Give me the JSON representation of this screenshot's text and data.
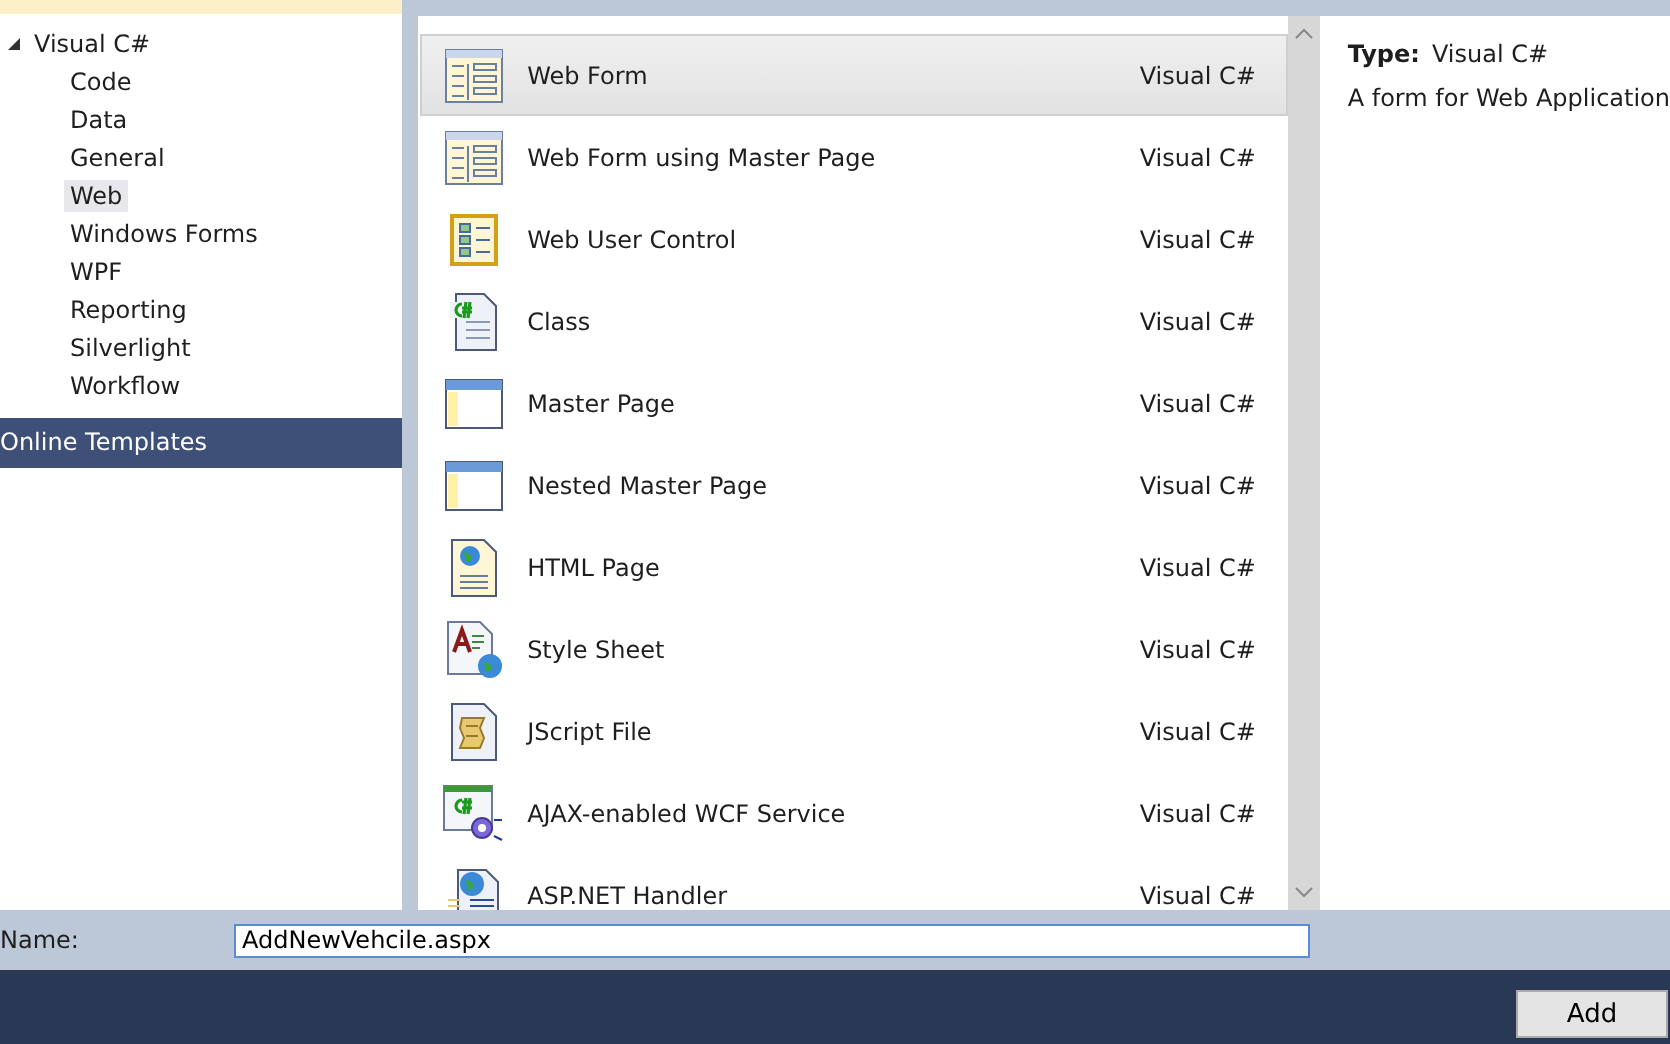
{
  "tree": {
    "root": {
      "label": "Visual C#",
      "expanded": true,
      "children": [
        {
          "label": "Code",
          "selected": false
        },
        {
          "label": "Data",
          "selected": false
        },
        {
          "label": "General",
          "selected": false
        },
        {
          "label": "Web",
          "selected": true
        },
        {
          "label": "Windows Forms",
          "selected": false
        },
        {
          "label": "WPF",
          "selected": false
        },
        {
          "label": "Reporting",
          "selected": false
        },
        {
          "label": "Silverlight",
          "selected": false
        },
        {
          "label": "Workflow",
          "selected": false
        }
      ]
    },
    "section": {
      "label": "Online Templates",
      "selected": true
    }
  },
  "templates": [
    {
      "name": "Web Form",
      "language": "Visual C#",
      "kind": "form",
      "selected": true
    },
    {
      "name": "Web Form using Master Page",
      "language": "Visual C#",
      "kind": "form",
      "selected": false
    },
    {
      "name": "Web User Control",
      "language": "Visual C#",
      "kind": "control",
      "selected": false
    },
    {
      "name": "Class",
      "language": "Visual C#",
      "kind": "class",
      "selected": false
    },
    {
      "name": "Master Page",
      "language": "Visual C#",
      "kind": "master",
      "selected": false
    },
    {
      "name": "Nested Master Page",
      "language": "Visual C#",
      "kind": "master",
      "selected": false
    },
    {
      "name": "HTML Page",
      "language": "Visual C#",
      "kind": "html",
      "selected": false
    },
    {
      "name": "Style Sheet",
      "language": "Visual C#",
      "kind": "css",
      "selected": false
    },
    {
      "name": "JScript File",
      "language": "Visual C#",
      "kind": "script",
      "selected": false
    },
    {
      "name": "AJAX-enabled WCF Service",
      "language": "Visual C#",
      "kind": "service",
      "selected": false
    },
    {
      "name": "ASP.NET Handler",
      "language": "Visual C#",
      "kind": "handler",
      "selected": false
    }
  ],
  "details": {
    "type_label": "Type:",
    "type_value": "Visual C#",
    "description": "A form for Web Application"
  },
  "name_field": {
    "label": "Name:",
    "value": "AddNewVehcile.aspx"
  },
  "buttons": [
    "Add"
  ]
}
